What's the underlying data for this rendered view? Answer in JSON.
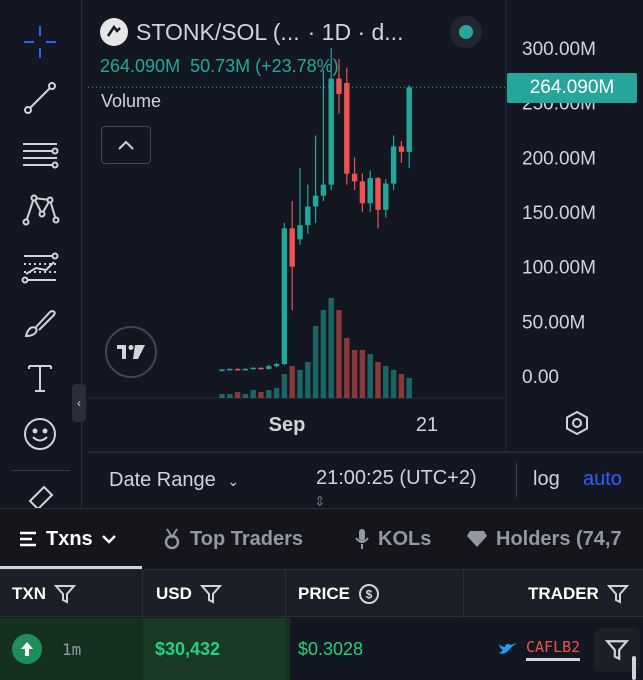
{
  "chart": {
    "symbol": "STONK/SOL (...",
    "interval": "· 1D · d...",
    "legend_price": "264.090M",
    "legend_change": "50.73M (+23.78%)",
    "volume_label": "Volume",
    "price_tag": "264.090M",
    "y_axis_labels": [
      "300.00M",
      "250.00M",
      "200.00M",
      "150.00M",
      "100.00M",
      "50.00M",
      "0.00"
    ],
    "x_axis_labels": [
      "Sep",
      "21"
    ],
    "up_color": "#26a69a",
    "down_color": "#ef5350"
  },
  "chart_data": {
    "type": "candlestick",
    "ylim": [
      0,
      300000000
    ],
    "last_price": 264090000,
    "candles": [
      {
        "o": 5,
        "h": 6,
        "l": 4,
        "c": 6
      },
      {
        "o": 6,
        "h": 7,
        "l": 5,
        "c": 6.5
      },
      {
        "o": 6.5,
        "h": 7,
        "l": 5,
        "c": 5.5
      },
      {
        "o": 5.5,
        "h": 7,
        "l": 5,
        "c": 6.5
      },
      {
        "o": 6.5,
        "h": 8,
        "l": 6,
        "c": 7.5
      },
      {
        "o": 7.5,
        "h": 8,
        "l": 6,
        "c": 6.5
      },
      {
        "o": 6.5,
        "h": 10,
        "l": 6,
        "c": 9
      },
      {
        "o": 9,
        "h": 12,
        "l": 8,
        "c": 11
      },
      {
        "o": 11,
        "h": 140,
        "l": 10,
        "c": 135
      },
      {
        "o": 135,
        "h": 160,
        "l": 60,
        "c": 100
      },
      {
        "o": 125,
        "h": 190,
        "l": 120,
        "c": 138
      },
      {
        "o": 138,
        "h": 175,
        "l": 130,
        "c": 155
      },
      {
        "o": 155,
        "h": 220,
        "l": 140,
        "c": 165
      },
      {
        "o": 165,
        "h": 280,
        "l": 160,
        "c": 175
      },
      {
        "o": 175,
        "h": 300,
        "l": 170,
        "c": 272
      },
      {
        "o": 272,
        "h": 290,
        "l": 240,
        "c": 258
      },
      {
        "o": 268,
        "h": 282,
        "l": 175,
        "c": 185
      },
      {
        "o": 185,
        "h": 200,
        "l": 170,
        "c": 178
      },
      {
        "o": 178,
        "h": 185,
        "l": 150,
        "c": 158
      },
      {
        "o": 158,
        "h": 188,
        "l": 150,
        "c": 181
      },
      {
        "o": 181,
        "h": 182,
        "l": 135,
        "c": 152
      },
      {
        "o": 152,
        "h": 180,
        "l": 145,
        "c": 176
      },
      {
        "o": 176,
        "h": 220,
        "l": 170,
        "c": 210
      },
      {
        "o": 210,
        "h": 215,
        "l": 195,
        "c": 205
      },
      {
        "o": 205,
        "h": 266,
        "l": 190,
        "c": 264
      }
    ],
    "volume": [
      1,
      1,
      1.5,
      1,
      2,
      1.5,
      2,
      2.5,
      6,
      8,
      7,
      9,
      18,
      22,
      25,
      22,
      15,
      12,
      12,
      11,
      9,
      8,
      7,
      6,
      5
    ],
    "x_labels": [
      "Sep",
      "21"
    ]
  },
  "toolbar": {
    "tools": [
      "crosshair-icon",
      "trend-line-icon",
      "horizontal-lines-icon",
      "pattern-icon",
      "projection-icon",
      "brush-icon",
      "text-icon",
      "emoji-icon"
    ]
  },
  "footer": {
    "date_range": "Date Range",
    "clock": "21:00:25 (UTC+2)",
    "log": "log",
    "auto": "auto"
  },
  "tabs": [
    {
      "label": "Txns"
    },
    {
      "label": "Top Traders"
    },
    {
      "label": "KOLs"
    },
    {
      "label": "Holders (74,7"
    }
  ],
  "table": {
    "headers": [
      "TXN",
      "USD",
      "PRICE",
      "TRADER"
    ],
    "row": {
      "age": "1m",
      "usd": "$30,432",
      "price": "$0.3028",
      "trader": "CAFLB2"
    }
  }
}
